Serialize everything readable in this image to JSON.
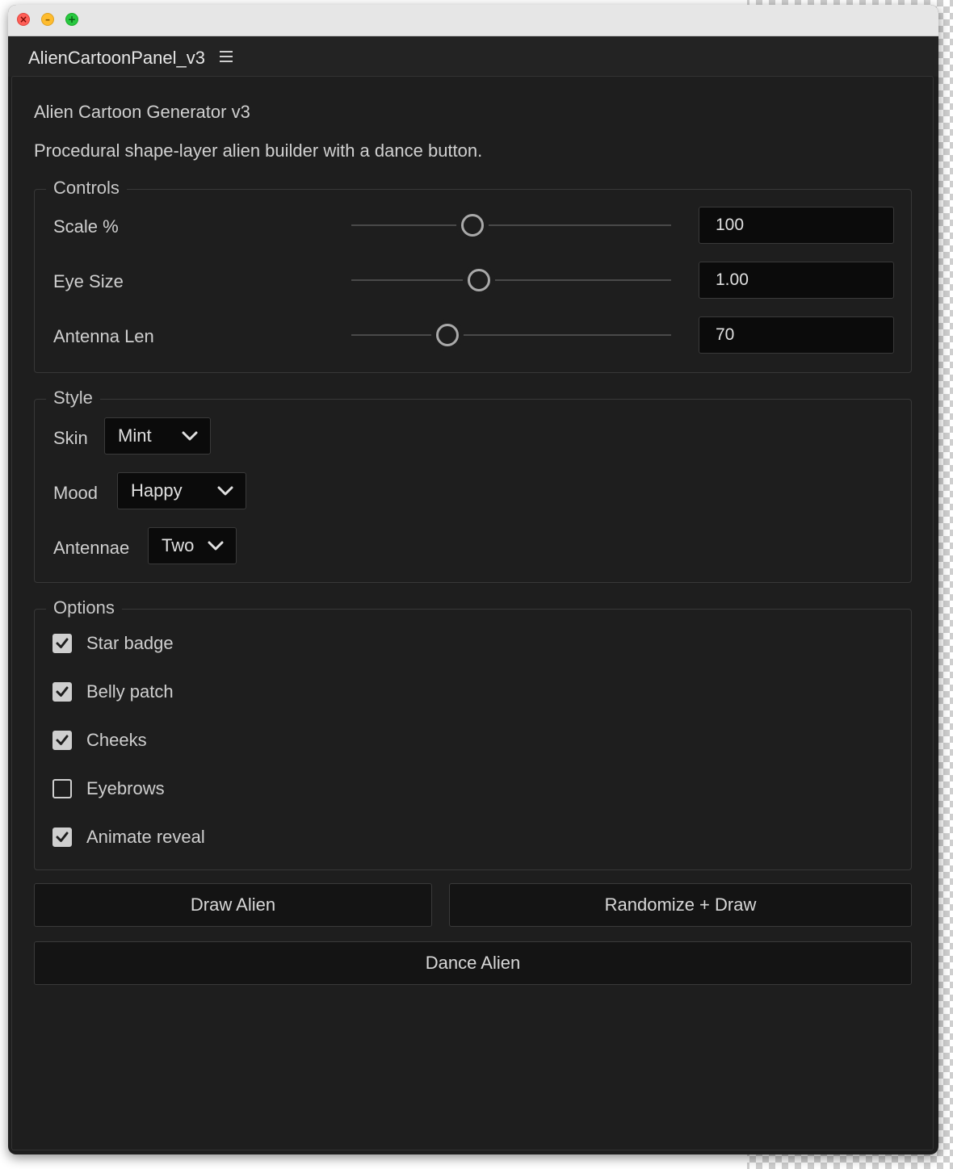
{
  "window": {
    "traffic_lights": {
      "close_glyph": "×",
      "minimize_glyph": "–",
      "maximize_glyph": "+"
    }
  },
  "panel": {
    "title": "AlienCartoonPanel_v3",
    "menu_icon": "hamburger-menu-icon"
  },
  "header": {
    "title": "Alien Cartoon Generator v3",
    "description": "Procedural shape-layer alien builder with a dance button."
  },
  "controls": {
    "legend": "Controls",
    "sliders": [
      {
        "label": "Scale %",
        "value": "100",
        "fraction": 0.38
      },
      {
        "label": "Eye Size",
        "value": "1.00",
        "fraction": 0.4
      },
      {
        "label": "Antenna Len",
        "value": "70",
        "fraction": 0.3
      }
    ]
  },
  "style": {
    "legend": "Style",
    "skin": {
      "label": "Skin",
      "value": "Mint"
    },
    "mood": {
      "label": "Mood",
      "value": "Happy"
    },
    "antennae": {
      "label": "Antennae",
      "value": "Two"
    }
  },
  "options": {
    "legend": "Options",
    "items": [
      {
        "label": "Star badge",
        "checked": true
      },
      {
        "label": "Belly patch",
        "checked": true
      },
      {
        "label": "Cheeks",
        "checked": true
      },
      {
        "label": "Eyebrows",
        "checked": false
      },
      {
        "label": "Animate reveal",
        "checked": true
      }
    ]
  },
  "actions": {
    "draw": "Draw Alien",
    "randomize": "Randomize + Draw",
    "dance": "Dance Alien"
  },
  "colors": {
    "panel_bg": "#1e1e1e",
    "input_bg": "#0b0b0b",
    "text": "#cfcfcf",
    "close": "#ff5f57",
    "minimize": "#febc2e",
    "maximize": "#28c840"
  }
}
